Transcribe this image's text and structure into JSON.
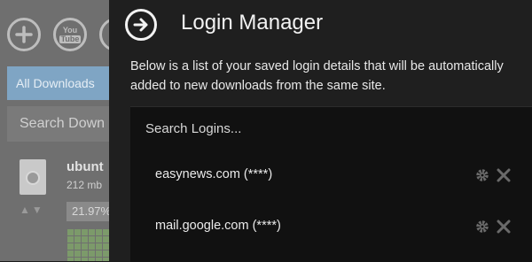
{
  "background_app": {
    "buttons": [
      {
        "icon": "plus-icon"
      },
      {
        "icon": "youtube-icon",
        "line1": "You",
        "line2": "Tube"
      }
    ],
    "all_downloads_label": "All Downloads",
    "search_label": "Search Down",
    "download": {
      "name": "ubunt",
      "size": "212 mb",
      "progress": "21.97%"
    }
  },
  "login_manager": {
    "title": "Login Manager",
    "description": "Below is a list of your saved login details that will be automatically added to new downloads from the same site.",
    "search_placeholder": "Search Logins...",
    "logins": [
      {
        "label": "easynews.com (****)"
      },
      {
        "label": "mail.google.com (****)"
      }
    ],
    "colors": {
      "panel": "#1f1f1f",
      "list": "#111111",
      "text": "#eaeaea",
      "icon": "#6a6a6a"
    }
  }
}
